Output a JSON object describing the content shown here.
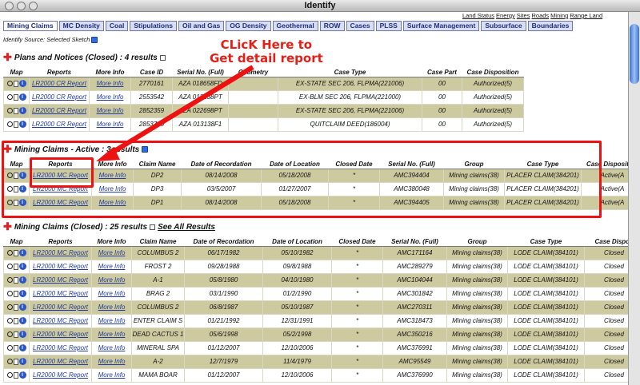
{
  "window": {
    "title": "Identify"
  },
  "tabs": [
    "Mining Claims",
    "MC Density",
    "Coal",
    "Stipulations",
    "Oil and Gas",
    "OG Density",
    "Geothermal",
    "ROW",
    "Cases",
    "PLSS",
    "Surface Management",
    "Subsurface",
    "Boundaries"
  ],
  "right_links": [
    "Land Status",
    "Energy",
    "Sites",
    "Roads",
    "Mining",
    "Range Land"
  ],
  "identify_source": "Identify Source: Selected Sketch",
  "annotation": {
    "line1": "CLicK Here to",
    "line2": "Get detail report"
  },
  "plans": {
    "heading": "Plans and Notices (Closed) : 4 results",
    "columns": [
      "Map",
      "Reports",
      "More Info",
      "Case ID",
      "Serial No. (Full)",
      "Geometry",
      "Case Type",
      "Case Part",
      "Case Disposition"
    ],
    "rows": [
      [
        "LR2000 CR Report",
        "More Info",
        "2770161",
        "AZA 018658FD",
        "",
        "EX-STATE SEC 206, FLPMA(221006)",
        "00",
        "Authorized(5)"
      ],
      [
        "LR2000 CR Report",
        "More Info",
        "2553542",
        "AZA 013138PT",
        "",
        "EX-BLM SEC 206, FLPMA(221000)",
        "00",
        "Authorized(5)"
      ],
      [
        "LR2000 CR Report",
        "More Info",
        "2852359",
        "AZA 022698PT",
        "",
        "EX-STATE SEC 206, FLPMA(221006)",
        "00",
        "Authorized(5)"
      ],
      [
        "LR2000 CR Report",
        "More Info",
        "2853720",
        "AZA 013138F1",
        "",
        "QUITCLAIM DEED(186004)",
        "00",
        "Authorized(5)"
      ]
    ]
  },
  "active": {
    "heading": "Mining Claims - Active : 3 results",
    "columns": [
      "Map",
      "Reports",
      "More Info",
      "Claim Name",
      "Date of Recordation",
      "Date of Location",
      "Closed Date",
      "Serial No. (Full)",
      "Group",
      "Case Type",
      "Case Disposition"
    ],
    "rows": [
      [
        "LR2000 MC Report",
        "More Info",
        "DP2",
        "08/14/2008",
        "05/18/2008",
        "*",
        "AMC394404",
        "Mining claims(38)",
        "PLACER CLAIM(384201)",
        "Active(A"
      ],
      [
        "LR2000 MC Report",
        "More Info",
        "DP3",
        "03/5/2007",
        "01/27/2007",
        "*",
        "AMC380048",
        "Mining claims(38)",
        "PLACER CLAIM(384201)",
        "Active(A"
      ],
      [
        "LR2000 MC Report",
        "More Info",
        "DP1",
        "08/14/2008",
        "05/18/2008",
        "*",
        "AMC394405",
        "Mining claims(38)",
        "PLACER CLAIM(384201)",
        "Active(A"
      ]
    ]
  },
  "closed": {
    "heading": "Mining Claims (Closed) : 25 results",
    "see_all": "See All Results",
    "columns": [
      "Map",
      "Reports",
      "More Info",
      "Claim Name",
      "Date of Recordation",
      "Date of Location",
      "Closed Date",
      "Serial No. (Full)",
      "Group",
      "Case Type",
      "Case Dispos"
    ],
    "rows": [
      [
        "LR2000 MC Report",
        "More Info",
        "COLUMBUS 2",
        "06/17/1982",
        "05/10/1982",
        "*",
        "AMC171164",
        "Mining claims(38)",
        "LODE CLAIM(384101)",
        "Closed"
      ],
      [
        "LR2000 MC Report",
        "More Info",
        "FROST 2",
        "09/28/1988",
        "09/8/1988",
        "*",
        "AMC289279",
        "Mining claims(38)",
        "LODE CLAIM(384101)",
        "Closed"
      ],
      [
        "LR2000 MC Report",
        "More Info",
        "A-1",
        "05/8/1980",
        "04/10/1980",
        "*",
        "AMC104044",
        "Mining claims(38)",
        "LODE CLAIM(384101)",
        "Closed"
      ],
      [
        "LR2000 MC Report",
        "More Info",
        "BRAG 2",
        "03/1/1990",
        "01/2/1990",
        "*",
        "AMC301842",
        "Mining claims(38)",
        "LODE CLAIM(384101)",
        "Closed"
      ],
      [
        "LR2000 MC Report",
        "More Info",
        "COLUMBUS 2",
        "06/8/1987",
        "05/10/1987",
        "*",
        "AMC270311",
        "Mining claims(38)",
        "LODE CLAIM(384101)",
        "Closed"
      ],
      [
        "LR2000 MC Report",
        "More Info",
        "ENTER CLAIM S",
        "01/21/1992",
        "12/31/1991",
        "*",
        "AMC318473",
        "Mining claims(38)",
        "LODE CLAIM(384101)",
        "Closed"
      ],
      [
        "LR2000 MC Report",
        "More Info",
        "DEAD CACTUS 1",
        "05/6/1998",
        "05/2/1998",
        "*",
        "AMC350216",
        "Mining claims(38)",
        "LODE CLAIM(384101)",
        "Closed"
      ],
      [
        "LR2000 MC Report",
        "More Info",
        "MINERAL SPA",
        "01/12/2007",
        "12/10/2006",
        "*",
        "AMC376991",
        "Mining claims(38)",
        "LODE CLAIM(384101)",
        "Closed"
      ],
      [
        "LR2000 MC Report",
        "More Info",
        "A-2",
        "12/7/1979",
        "11/4/1979",
        "*",
        "AMC95549",
        "Mining claims(38)",
        "LODE CLAIM(384101)",
        "Closed"
      ],
      [
        "LR2000 MC Report",
        "More Info",
        "MAMA BOAR",
        "01/12/2007",
        "12/10/2006",
        "*",
        "AMC376990",
        "Mining claims(38)",
        "LODE CLAIM(384101)",
        "Closed"
      ]
    ]
  }
}
